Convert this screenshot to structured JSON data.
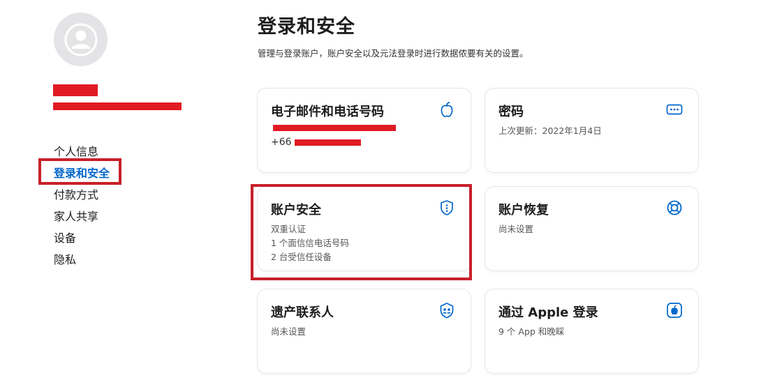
{
  "sidebar": {
    "items": [
      {
        "label": "个人信息"
      },
      {
        "label": "登录和安全"
      },
      {
        "label": "付款方式"
      },
      {
        "label": "家人共享"
      },
      {
        "label": "设备"
      },
      {
        "label": "隐私"
      }
    ],
    "active_index": 1
  },
  "main": {
    "title": "登录和安全",
    "subtitle": "管理与登录账户，账户安全以及元法登录时进行数据侬要有关的设置。",
    "cards": [
      {
        "title": "电子邮件和电话号码",
        "lines": [
          "",
          "+66"
        ],
        "icon": "apple-icon"
      },
      {
        "title": "密码",
        "lines": [
          "上次更新：2022年1月4日"
        ],
        "icon": "password-dots-icon"
      },
      {
        "title": "账户安全",
        "lines": [
          "双重认证",
          "1 个面信信电话号码",
          "2 台受信任设备"
        ],
        "icon": "shield-icon"
      },
      {
        "title": "账户恢复",
        "lines": [
          "尚未设置"
        ],
        "icon": "lifebuoy-icon"
      },
      {
        "title": "遗产联系人",
        "lines": [
          "尚未设置"
        ],
        "icon": "legacy-contact-icon"
      },
      {
        "title": "通过 Apple 登录",
        "lines": [
          "9 个 App 和晚睬"
        ],
        "icon": "apple-square-icon"
      }
    ]
  },
  "colors": {
    "accent": "#0066cc",
    "highlight_box": "#c8202a",
    "redaction": "#e01b24",
    "avatar_bg": "#e4e4e6"
  }
}
